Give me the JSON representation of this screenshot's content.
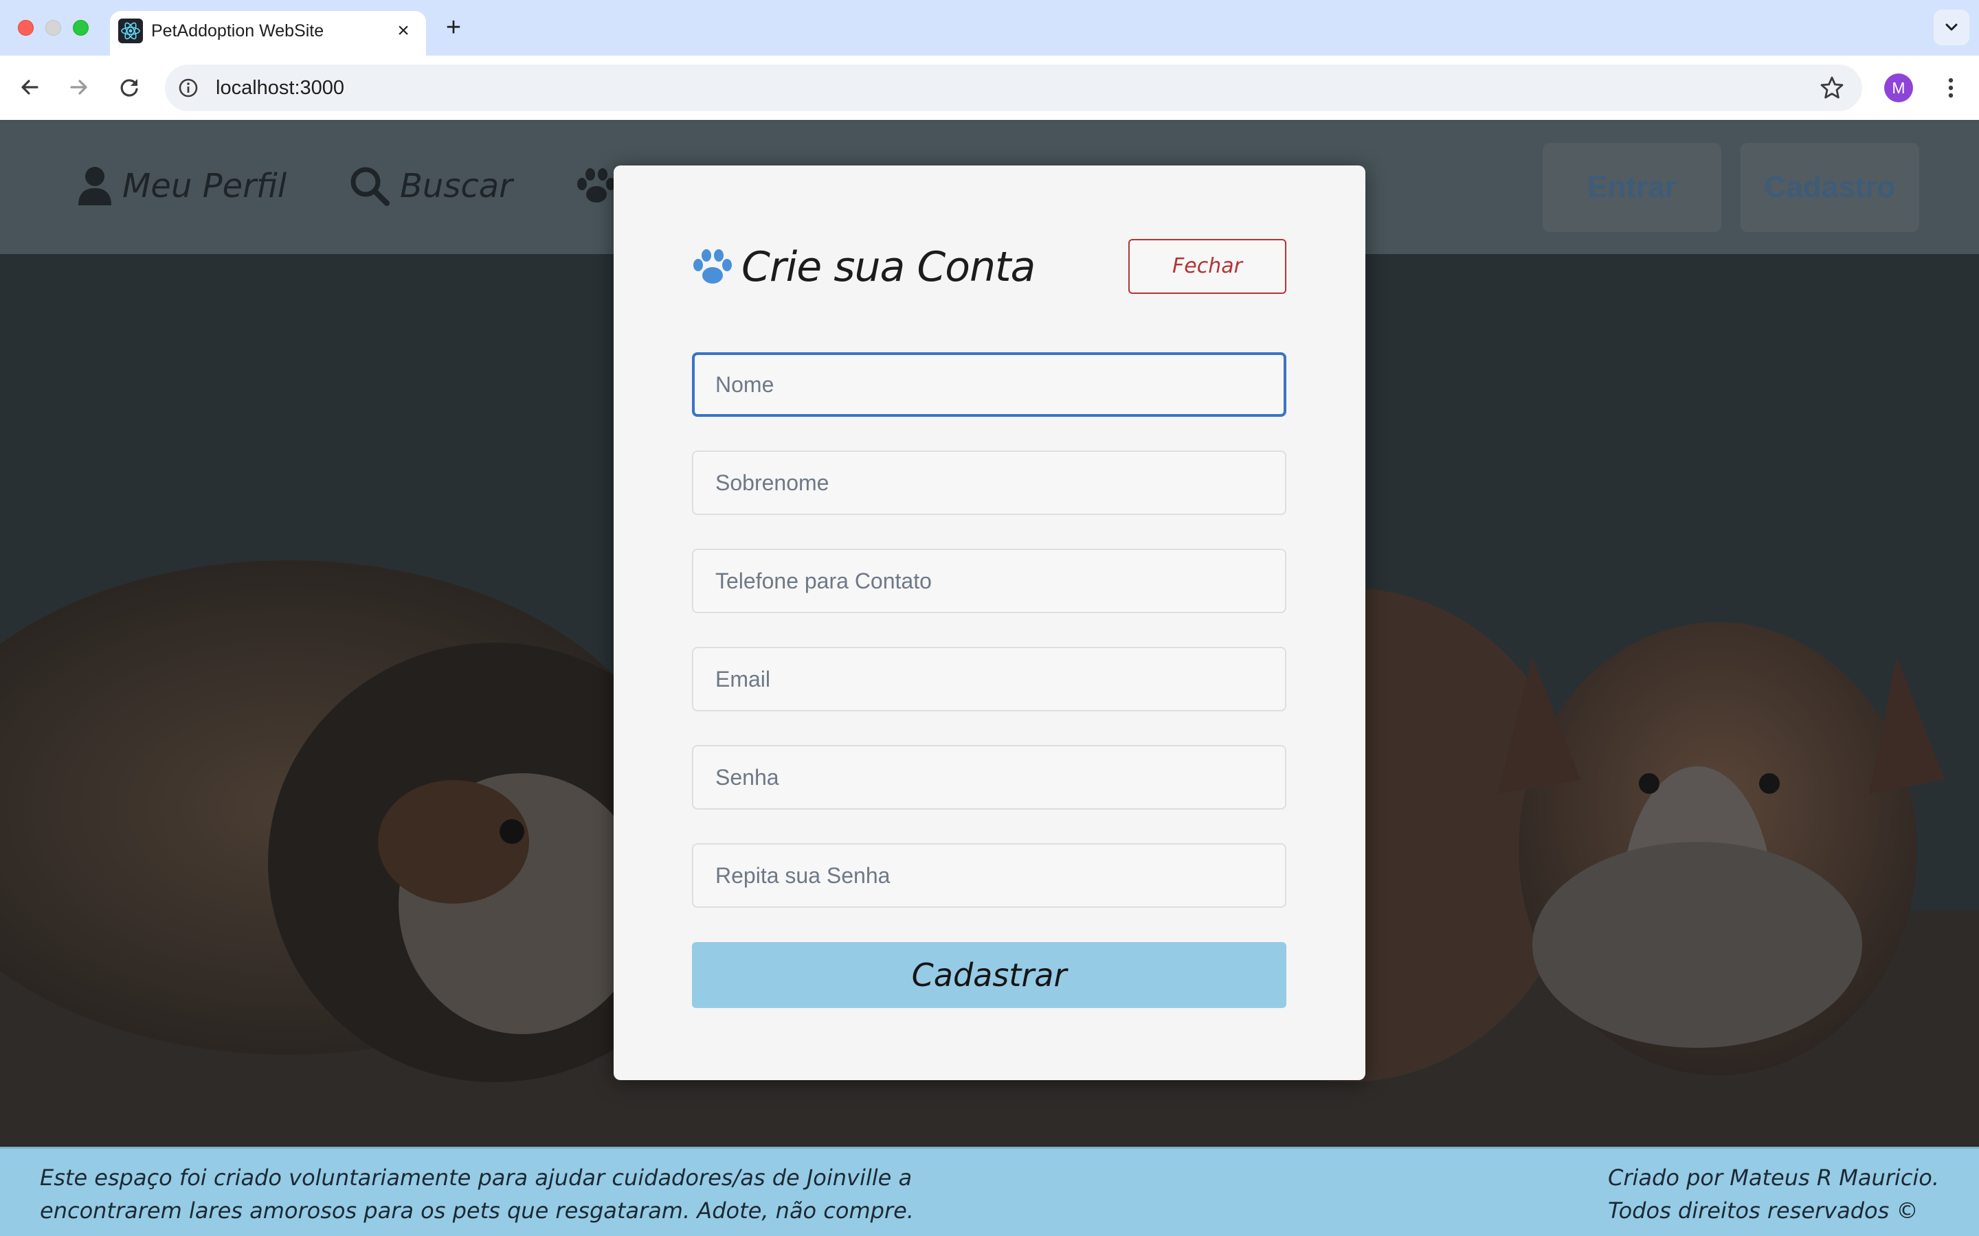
{
  "browser": {
    "tab_title": "PetAddoption WebSite",
    "url": "localhost:3000",
    "profile_initial": "M"
  },
  "nav": {
    "profile_label": "Meu Perfil",
    "search_label": "Buscar",
    "login_label": "Entrar",
    "signup_label": "Cadastro"
  },
  "modal": {
    "title": "Crie sua Conta",
    "close_label": "Fechar",
    "fields": {
      "first_name_placeholder": "Nome",
      "last_name_placeholder": "Sobrenome",
      "phone_placeholder": "Telefone para Contato",
      "email_placeholder": "Email",
      "password_placeholder": "Senha",
      "repeat_password_placeholder": "Repita sua Senha"
    },
    "submit_label": "Cadastrar"
  },
  "footer": {
    "left_line1": "Este espaço foi criado voluntariamente para ajudar cuidadores/as de Joinville a",
    "left_line2": "encontrarem lares amorosos para os pets que resgataram. Adote, não compre.",
    "right_line1": "Criado por Mateus R Mauricio.",
    "right_line2": "Todos direitos reservados ©"
  },
  "colors": {
    "accent": "#96cbe6",
    "focus_border": "#3a73c6",
    "close_red": "#b33434",
    "paw_blue": "#4a90d9"
  }
}
